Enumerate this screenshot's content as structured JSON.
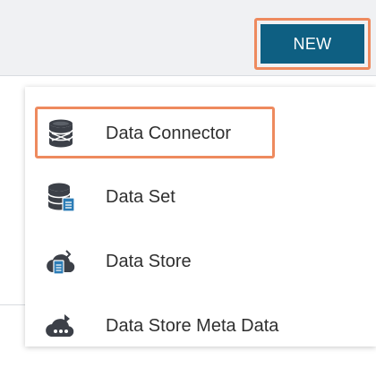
{
  "toolbar": {
    "new_label": "NEW"
  },
  "menu": {
    "items": [
      {
        "label": "Data Connector",
        "icon": "database-connector-icon"
      },
      {
        "label": "Data Set",
        "icon": "database-dataset-icon"
      },
      {
        "label": "Data Store",
        "icon": "cloud-store-icon"
      },
      {
        "label": "Data Store Meta Data",
        "icon": "cloud-store-metadata-icon"
      }
    ]
  },
  "colors": {
    "accent_primary": "#0e5f82",
    "highlight_outline": "#ee8a5e",
    "toolbar_bg": "#f0f1f3",
    "icon_dark": "#3c4048"
  }
}
